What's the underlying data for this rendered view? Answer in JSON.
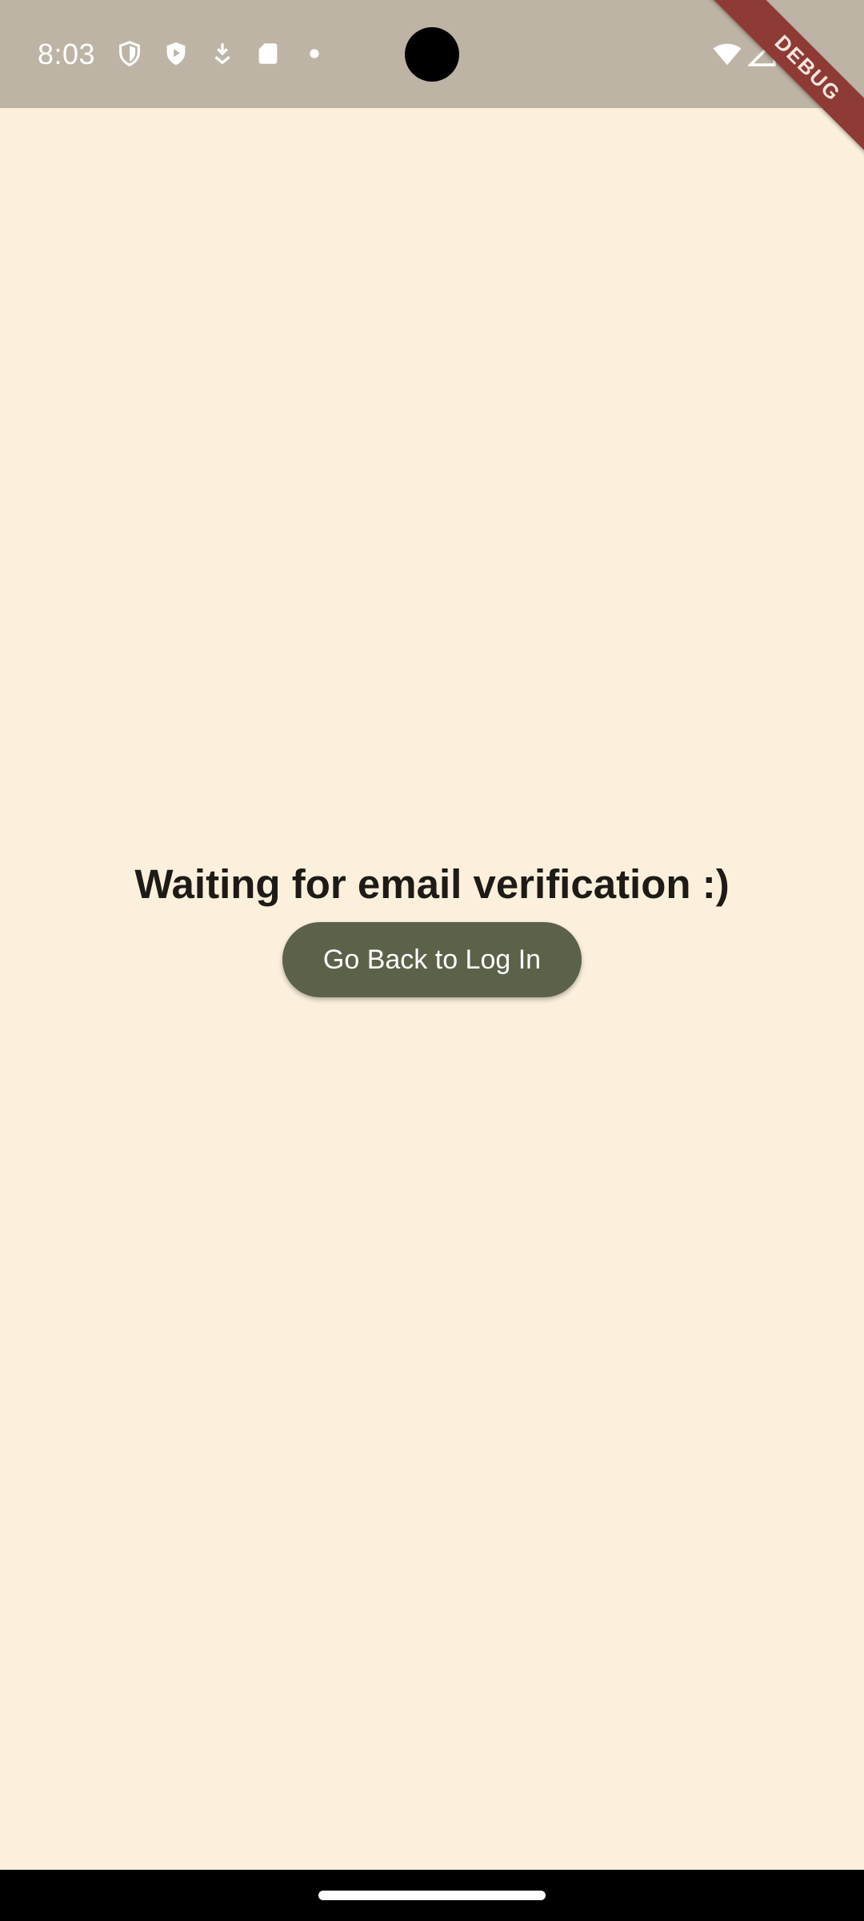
{
  "status_bar": {
    "time": "8:03",
    "left_icons": [
      "shield-outline-icon",
      "shield-play-icon",
      "download-icon",
      "sd-card-icon",
      "dot-icon"
    ],
    "right_icons": [
      "wifi-icon",
      "signal-icon",
      "battery-icon"
    ]
  },
  "debug_banner": {
    "label": "DEBUG"
  },
  "main": {
    "title": "Waiting for email verification :)",
    "back_button_label": "Go Back to Log In"
  },
  "colors": {
    "background": "#FCF0DC",
    "status_bar": "#BEB4A5",
    "button": "#5C6249",
    "debug_ribbon": "#8E3B35"
  }
}
